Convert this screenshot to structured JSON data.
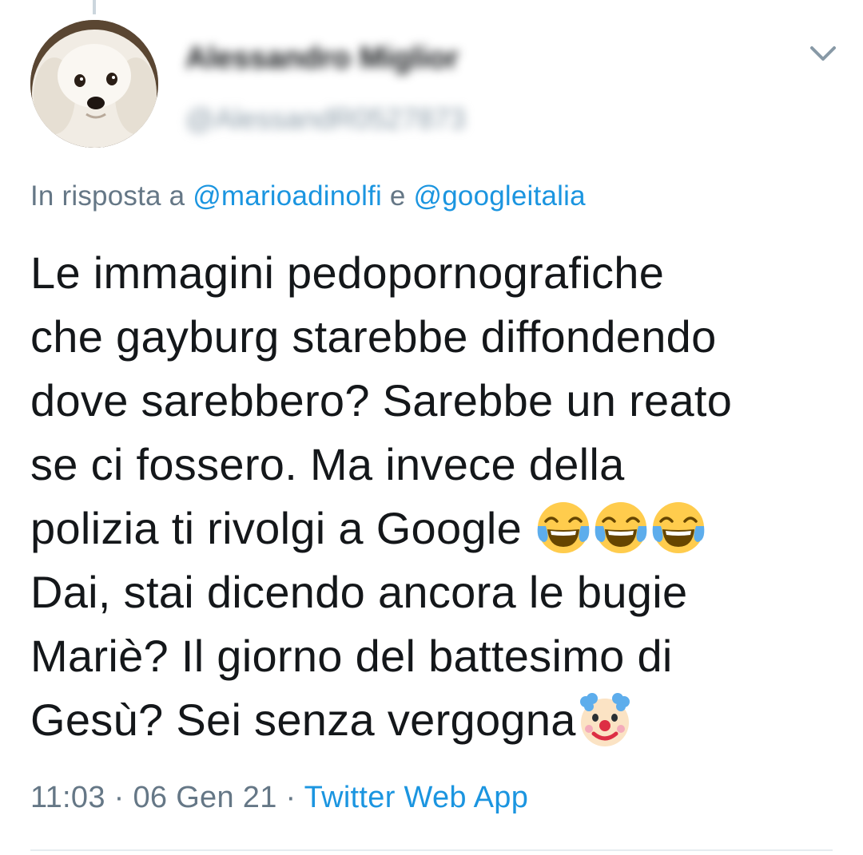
{
  "tweet": {
    "author": {
      "display_name": "Alessandro Miglior",
      "handle": "@AlessandR0527873",
      "avatar_icon": "dog-avatar"
    },
    "reply_prefix": "In risposta a",
    "reply_conjunction": "e",
    "mentions": [
      "@marioadinolfi",
      "@googleitalia"
    ],
    "text_lines": [
      "Le immagini pedopornografiche",
      "che gayburg starebbe diffondendo",
      "dove sarebbero? Sarebbe un reato",
      "se ci fossero. Ma invece della",
      "polizia ti rivolgi a Google",
      "Dai, stai dicendo ancora le bugie",
      "Mariè? Il giorno del battesimo di",
      "Gesù? Sei senza vergogna"
    ],
    "emojis": {
      "laughing": "face-with-tears-of-joy-icon",
      "clown": "clown-face-icon"
    },
    "time": "11:03",
    "date": "06 Gen 21",
    "separator": "·",
    "source": "Twitter Web App",
    "colors": {
      "link": "#1b95e0",
      "secondary_text": "#657786",
      "primary_text": "#14171a"
    }
  }
}
